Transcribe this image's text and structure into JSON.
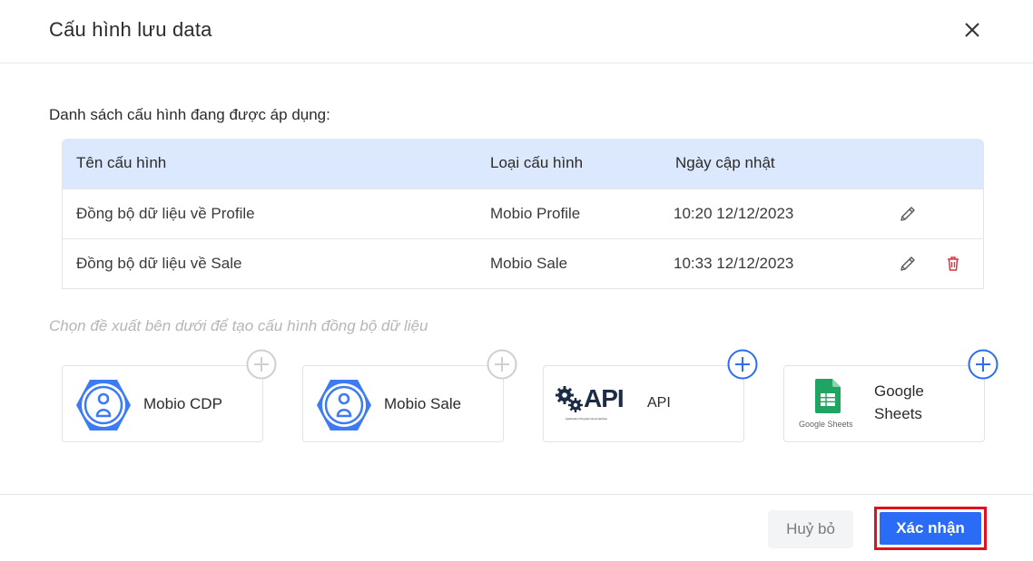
{
  "dialog": {
    "title": "Cấu hình lưu data"
  },
  "applied": {
    "label": "Danh sách cấu hình đang được áp dụng:",
    "columns": [
      "Tên cấu hình",
      "Loại cấu hình",
      "Ngày cập nhật"
    ],
    "rows": [
      {
        "name": "Đồng bộ dữ liệu về Profile",
        "type": "Mobio Profile",
        "updated": "10:20 12/12/2023"
      },
      {
        "name": "Đồng bộ dữ liệu về Sale",
        "type": "Mobio Sale",
        "updated": "10:33 12/12/2023"
      }
    ]
  },
  "suggest": {
    "hint": "Chọn đề xuất bên dưới để tạo cấu hình đồng bộ dữ liệu",
    "cards": [
      {
        "label": "Mobio CDP",
        "icon": "mobio-hexagon-icon",
        "enabled": false
      },
      {
        "label": "Mobio Sale",
        "icon": "mobio-hexagon-icon",
        "enabled": false
      },
      {
        "label": "API",
        "logo_text": "API",
        "logo_caption": "Application Programming Interface",
        "icon": "gears-icon",
        "enabled": true
      },
      {
        "label_line1": "Google",
        "label_line2": "Sheets",
        "logo_caption": "Google Sheets",
        "icon": "google-sheets-icon",
        "enabled": true
      }
    ]
  },
  "footer": {
    "cancel_label": "Huỷ bỏ",
    "confirm_label": "Xác nhận"
  },
  "colors": {
    "accent": "#2b6cf6",
    "table_header": "#dbe8fd",
    "delete": "#e0303a",
    "highlight": "#e0101e"
  }
}
